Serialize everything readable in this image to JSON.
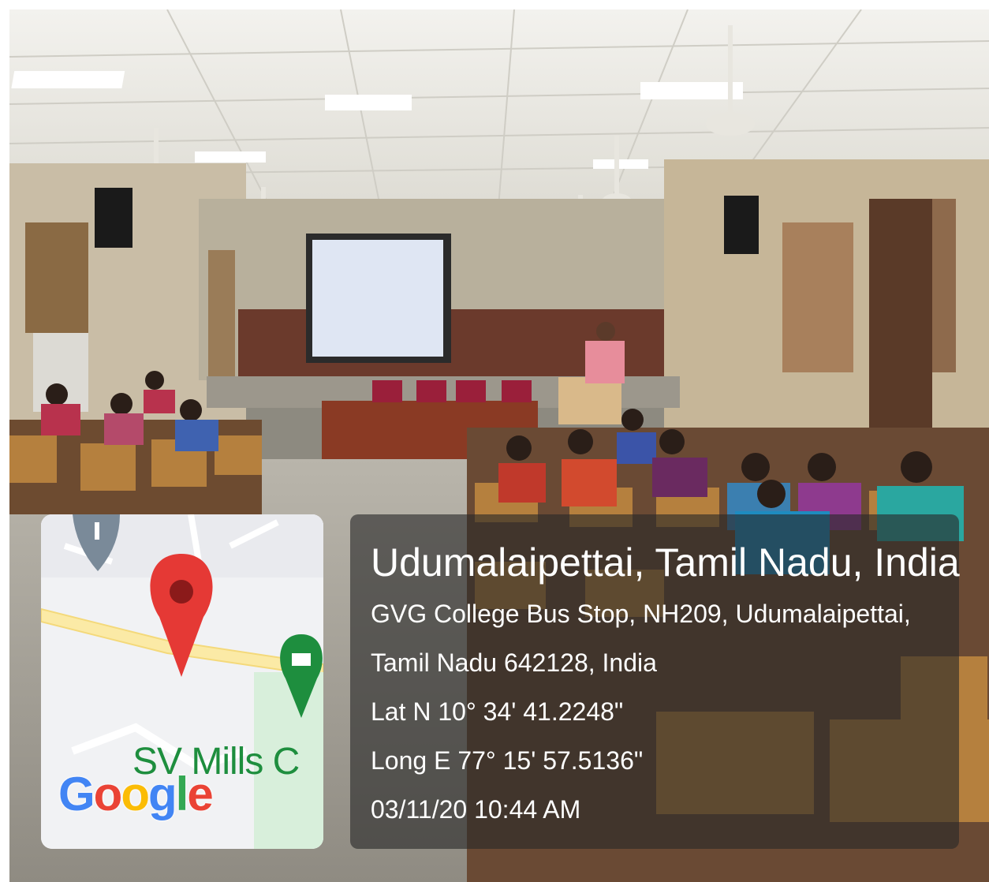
{
  "overlay": {
    "location_title": "Udumalaipettai, Tamil Nadu, India",
    "address_line_1": "GVG College Bus Stop, NH209, Udumalaipettai,",
    "address_line_2": "Tamil Nadu 642128, India",
    "latitude": "Lat N 10° 34' 41.2248\"",
    "longitude": "Long E 77° 15' 57.5136\"",
    "timestamp": "03/11/20 10:44 AM"
  },
  "map": {
    "place_label": "SV Mills C",
    "logo_letters": [
      "G",
      "o",
      "o",
      "g",
      "l",
      "e"
    ],
    "logo_colors": [
      "#4285F4",
      "#EA4335",
      "#FBBC05",
      "#4285F4",
      "#34A853",
      "#EA4335"
    ],
    "pin_color": "#e53935",
    "place_pin_color": "#1e8e3e",
    "icons": [
      "location-pin-icon",
      "place-marker-icon",
      "nav-pin-icon"
    ]
  }
}
